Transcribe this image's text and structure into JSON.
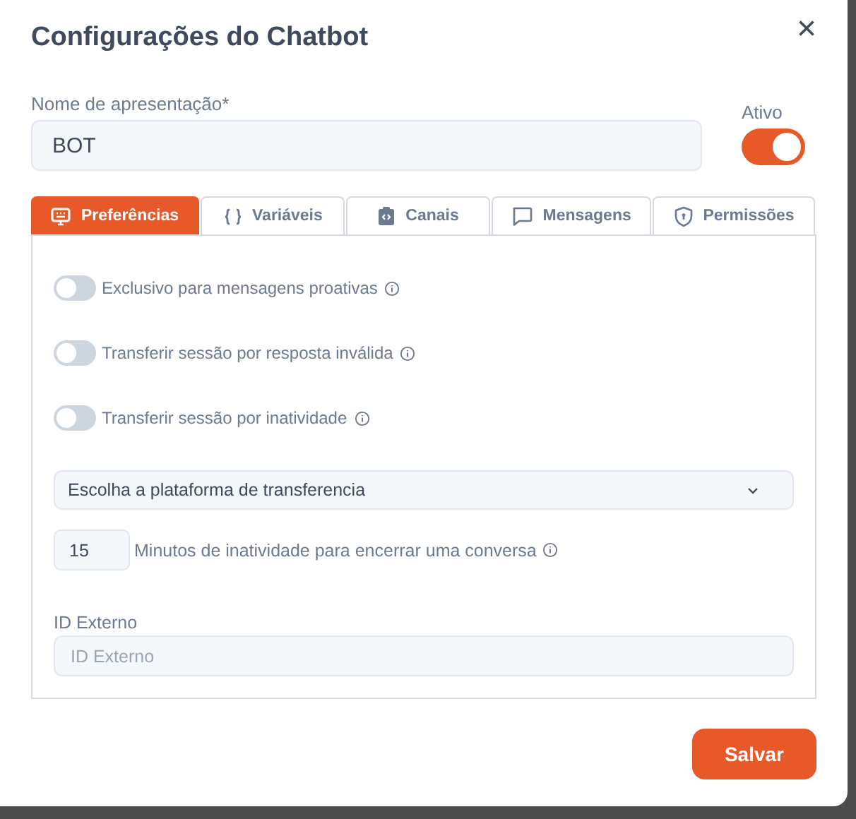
{
  "dialog": {
    "title": "Configurações do Chatbot",
    "close": "×"
  },
  "name_field": {
    "label": "Nome de apresentação*",
    "value": "BOT"
  },
  "active": {
    "label": "Ativo",
    "on": true
  },
  "tabs": [
    {
      "label": "Preferências",
      "kind": "monitor",
      "selected": true
    },
    {
      "label": "Variáveis",
      "kind": "braces",
      "selected": false
    },
    {
      "label": "Canais",
      "kind": "clipboard",
      "selected": false
    },
    {
      "label": "Mensagens",
      "kind": "chat",
      "selected": false
    },
    {
      "label": "Permissões",
      "kind": "shield",
      "selected": false
    }
  ],
  "switches": [
    {
      "label": "Exclusivo para mensagens proativas",
      "on": false
    },
    {
      "label": "Transferir sessão por resposta inválida",
      "on": false
    },
    {
      "label": "Transferir sessão por inatividade",
      "on": false
    }
  ],
  "platform_select": {
    "value": "Escolha a plataforma de transferencia"
  },
  "inactivity": {
    "value": "15",
    "label": "Minutos de inatividade para encerrar uma conversa"
  },
  "external_id": {
    "label": "ID Externo",
    "placeholder": "ID Externo"
  },
  "save_button": "Salvar"
}
